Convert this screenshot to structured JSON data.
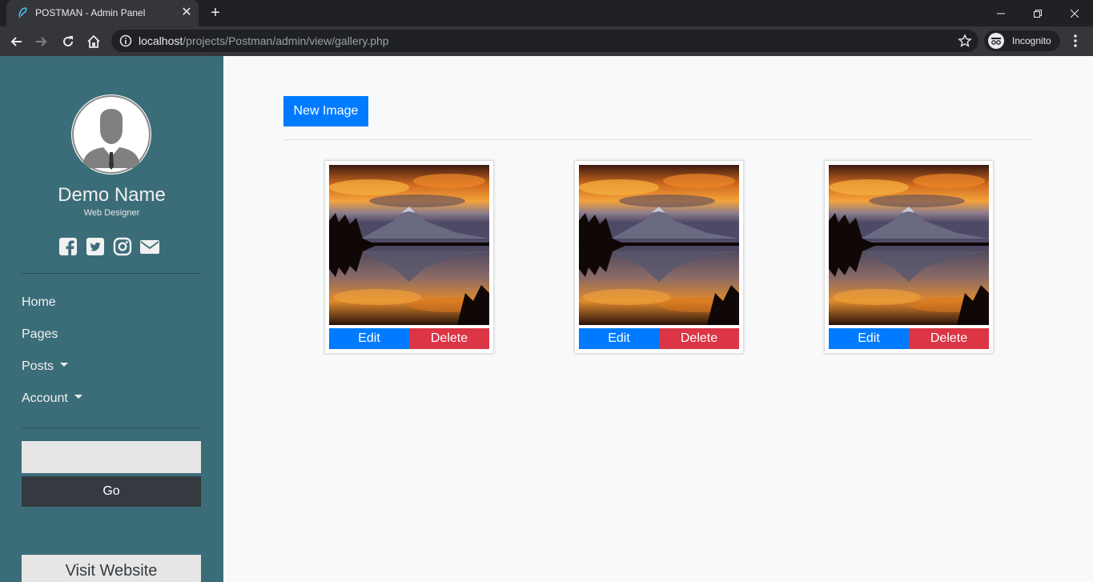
{
  "browser": {
    "tab_title": "POSTMAN - Admin Panel",
    "url_host": "localhost",
    "url_path": "/projects/Postman/admin/view/gallery.php",
    "incognito_label": "Incognito"
  },
  "sidebar": {
    "profile_name": "Demo Name",
    "profile_role": "Web Designer",
    "social_icons": [
      "facebook-icon",
      "twitter-icon",
      "instagram-icon",
      "envelope-icon"
    ],
    "nav": {
      "home": "Home",
      "pages": "Pages",
      "posts": "Posts",
      "account": "Account"
    },
    "search_value": "",
    "go_label": "Go",
    "visit_label": "Visit Website"
  },
  "main": {
    "new_image_label": "New Image",
    "cards": [
      {
        "edit_label": "Edit",
        "delete_label": "Delete"
      },
      {
        "edit_label": "Edit",
        "delete_label": "Delete"
      },
      {
        "edit_label": "Edit",
        "delete_label": "Delete"
      }
    ]
  },
  "colors": {
    "sidebar_bg": "#3b6d79",
    "primary": "#007bff",
    "danger": "#dc3545",
    "dark": "#343a40"
  }
}
